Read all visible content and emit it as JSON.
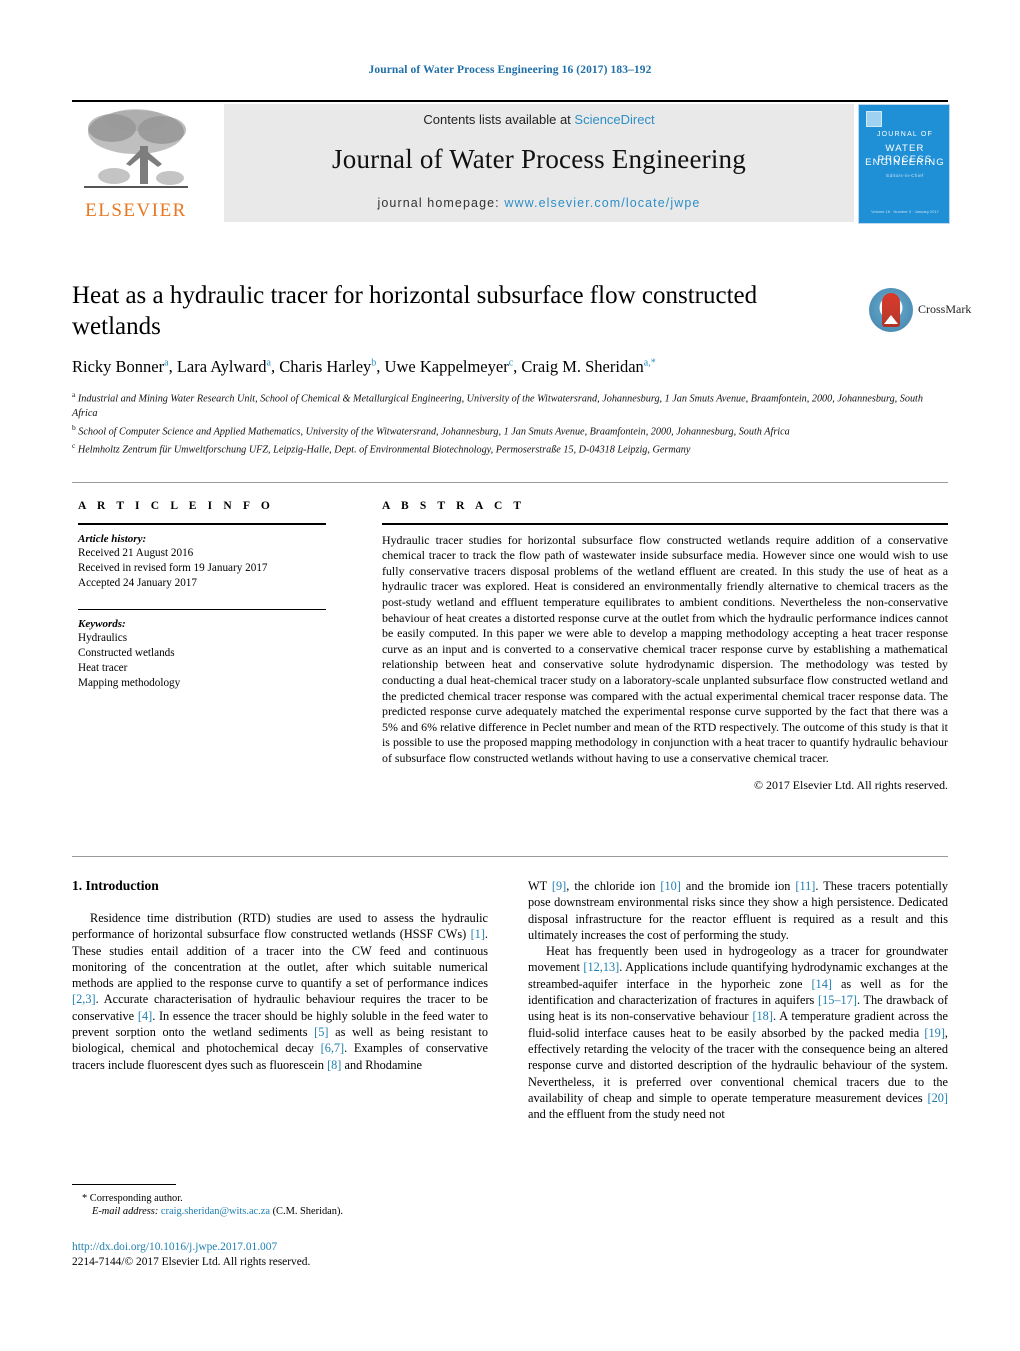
{
  "running_head": "Journal of Water Process Engineering 16 (2017) 183–192",
  "masthead": {
    "contents_prefix": "Contents lists available at ",
    "contents_link": "ScienceDirect",
    "journal_title": "Journal of Water Process Engineering",
    "homepage_prefix": "journal homepage: ",
    "homepage_url": "www.elsevier.com/locate/jwpe",
    "publisher_wordmark": "ELSEVIER"
  },
  "journal_cover": {
    "line1": "JOURNAL OF",
    "line2": "WATER PROCESS",
    "line3": "ENGINEERING",
    "subtitle": "Editors-in-Chief",
    "footer": "Volume 16 · Number 0 · January 2017"
  },
  "crossmark": {
    "label": "CrossMark"
  },
  "title": "Heat as a hydraulic tracer for horizontal subsurface flow constructed wetlands",
  "authors_html": "Ricky Bonner<sup>a</sup>, Lara Aylward<sup>a</sup>, Charis Harley<sup>b</sup>, Uwe Kappelmeyer<sup>c</sup>, Craig M. Sheridan<sup>a,<span class=\"star\">*</span></sup>",
  "affiliations": [
    "a Industrial and Mining Water Research Unit, School of Chemical & Metallurgical Engineering, University of the Witwatersrand, Johannesburg, 1 Jan Smuts Avenue, Braamfontein, 2000, Johannesburg, South Africa",
    "b School of Computer Science and Applied Mathematics, University of the Witwatersrand, Johannesburg, 1 Jan Smuts Avenue, Braamfontein, 2000, Johannesburg, South Africa",
    "c Helmholtz Zentrum für Umweltforschung UFZ, Leipzig-Halle, Dept. of Environmental Biotechnology, Permoserstraße 15, D-04318 Leipzig, Germany"
  ],
  "article_info": {
    "heading": "A R T I C L E  I N F O",
    "history_label": "Article history:",
    "history": [
      "Received 21 August 2016",
      "Received in revised form 19 January 2017",
      "Accepted 24 January 2017"
    ],
    "keywords_label": "Keywords:",
    "keywords": [
      "Hydraulics",
      "Constructed wetlands",
      "Heat tracer",
      "Mapping methodology"
    ]
  },
  "abstract": {
    "heading": "A B S T R A C T",
    "text": "Hydraulic tracer studies for horizontal subsurface flow constructed wetlands require addition of a conservative chemical tracer to track the flow path of wastewater inside subsurface media. However since one would wish to use fully conservative tracers disposal problems of the wetland effluent are created. In this study the use of heat as a hydraulic tracer was explored. Heat is considered an environmentally friendly alternative to chemical tracers as the post-study wetland and effluent temperature equilibrates to ambient conditions. Nevertheless the non-conservative behaviour of heat creates a distorted response curve at the outlet from which the hydraulic performance indices cannot be easily computed. In this paper we were able to develop a mapping methodology accepting a heat tracer response curve as an input and is converted to a conservative chemical tracer response curve by establishing a mathematical relationship between heat and conservative solute hydrodynamic dispersion. The methodology was tested by conducting a dual heat-chemical tracer study on a laboratory-scale unplanted subsurface flow constructed wetland and the predicted chemical tracer response was compared with the actual experimental chemical tracer response data. The predicted response curve adequately matched the experimental response curve supported by the fact that there was a 5% and 6% relative difference in Peclet number and mean of the RTD respectively. The outcome of this study is that it is possible to use the proposed mapping methodology in conjunction with a heat tracer to quantify hydraulic behaviour of subsurface flow constructed wetlands without having to use a conservative chemical tracer.",
    "copyright": "© 2017 Elsevier Ltd. All rights reserved."
  },
  "section": {
    "number_title": "1.  Introduction"
  },
  "body": {
    "left_paragraph_html": "Residence time distribution (RTD) studies are used to assess the hydraulic performance of horizontal subsurface flow constructed wetlands (HSSF CWs) <span class=\"ref\">[1]</span>. These studies entail addition of a tracer into the CW feed and continuous monitoring of the concentration at the outlet, after which suitable numerical methods are applied to the response curve to quantify a set of performance indices <span class=\"ref\">[2,3]</span>. Accurate characterisation of hydraulic behaviour requires the tracer to be conservative <span class=\"ref\">[4]</span>. In essence the tracer should be highly soluble in the feed water to prevent sorption onto the wetland sediments <span class=\"ref\">[5]</span> as well as being resistant to biological, chemical and photochemical decay <span class=\"ref\">[6,7]</span>. Examples of conservative tracers include fluorescent dyes such as fluorescein <span class=\"ref\">[8]</span> and Rhodamine",
    "right_paragraph_1_html": "WT <span class=\"ref\">[9]</span>, the chloride ion <span class=\"ref\">[10]</span> and the bromide ion <span class=\"ref\">[11]</span>. These tracers potentially pose downstream environmental risks since they show a high persistence. Dedicated disposal infrastructure for the reactor effluent is required as a result and this ultimately increases the cost of performing the study.",
    "right_paragraph_2_html": "Heat has frequently been used in hydrogeology as a tracer for groundwater movement <span class=\"ref\">[12,13]</span>. Applications include quantifying hydrodynamic exchanges at the streambed-aquifer interface in the hyporheic zone <span class=\"ref\">[14]</span> as well as for the identification and characterization of fractures in aquifers <span class=\"ref\">[15–17]</span>. The drawback of using heat is its non-conservative behaviour <span class=\"ref\">[18]</span>. A temperature gradient across the fluid-solid interface causes heat to be easily absorbed by the packed media <span class=\"ref\">[19]</span>, effectively retarding the velocity of the tracer with the consequence being an altered response curve and distorted description of the hydraulic behaviour of the system. Nevertheless, it is preferred over conventional chemical tracers due to the availability of cheap and simple to operate temperature measurement devices <span class=\"ref\">[20]</span> and the effluent from the study need not"
  },
  "footnotes": {
    "corresponding": "* Corresponding author.",
    "email_label": "E-mail address:",
    "email": "craig.sheridan@wits.ac.za",
    "email_suffix": " (C.M. Sheridan)."
  },
  "doi": {
    "url": "http://dx.doi.org/10.1016/j.jwpe.2017.01.007",
    "issn_line": "2214-7144/© 2017 Elsevier Ltd. All rights reserved."
  }
}
